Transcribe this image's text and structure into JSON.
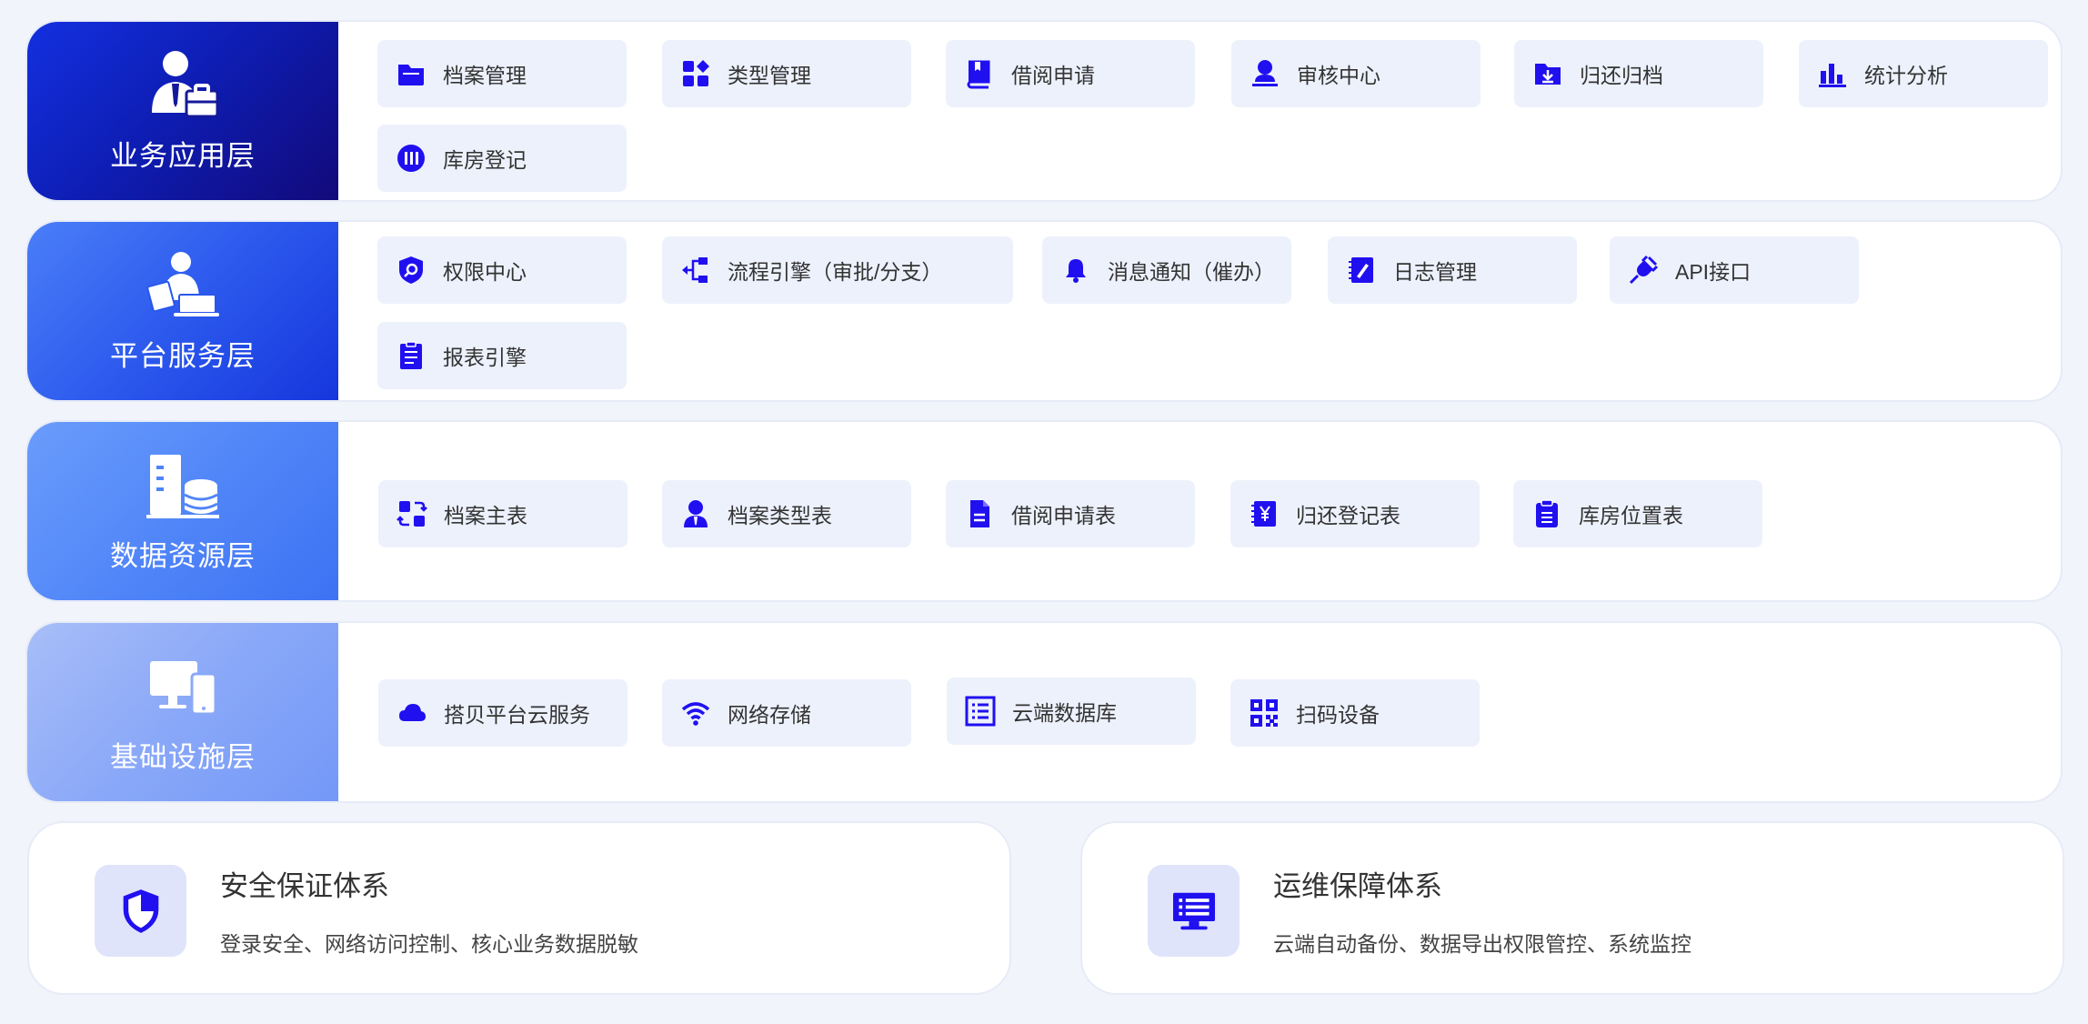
{
  "colors": {
    "accent": "#2010f0",
    "chip_bg": "#edf1fc",
    "page_bg": "#f1f4fb"
  },
  "layers": [
    {
      "title": "业务应用层",
      "icon": "businessman-briefcase-icon",
      "items": [
        {
          "label": "档案管理",
          "icon": "folder-icon"
        },
        {
          "label": "类型管理",
          "icon": "category-grid-icon"
        },
        {
          "label": "借阅申请",
          "icon": "book-icon"
        },
        {
          "label": "审核中心",
          "icon": "reviewer-person-icon"
        },
        {
          "label": "归还归档",
          "icon": "archive-download-icon"
        },
        {
          "label": "统计分析",
          "icon": "bar-chart-icon"
        },
        {
          "label": "库房登记",
          "icon": "warehouse-circle-icon"
        }
      ]
    },
    {
      "title": "平台服务层",
      "icon": "person-laptop-icon",
      "items": [
        {
          "label": "权限中心",
          "icon": "shield-search-icon"
        },
        {
          "label": "流程引擎（审批/分支）",
          "icon": "flow-branch-icon"
        },
        {
          "label": "消息通知（催办）",
          "icon": "bell-icon"
        },
        {
          "label": "日志管理",
          "icon": "notebook-icon"
        },
        {
          "label": "API接口",
          "icon": "plug-icon"
        },
        {
          "label": "报表引擎",
          "icon": "clipboard-list-icon"
        }
      ]
    },
    {
      "title": "数据资源层",
      "icon": "building-database-icon",
      "items": [
        {
          "label": "档案主表",
          "icon": "swap-arrows-icon"
        },
        {
          "label": "档案类型表",
          "icon": "user-tie-icon"
        },
        {
          "label": "借阅申请表",
          "icon": "document-icon"
        },
        {
          "label": "归还登记表",
          "icon": "yen-ledger-icon"
        },
        {
          "label": "库房位置表",
          "icon": "clipboard-icon"
        }
      ]
    },
    {
      "title": "基础设施层",
      "icon": "desktop-phone-icon",
      "items": [
        {
          "label": "搭贝平台云服务",
          "icon": "cloud-icon"
        },
        {
          "label": "网络存储",
          "icon": "wifi-icon"
        },
        {
          "label": "云端数据库",
          "icon": "list-box-icon"
        },
        {
          "label": "扫码设备",
          "icon": "qr-code-icon"
        }
      ]
    }
  ],
  "cards": [
    {
      "title": "安全保证体系",
      "desc": "登录安全、网络访问控制、核心业务数据脱敏",
      "icon": "security-shield-icon"
    },
    {
      "title": "运维保障体系",
      "desc": "云端自动备份、数据导出权限管控、系统监控",
      "icon": "monitor-list-icon"
    }
  ]
}
